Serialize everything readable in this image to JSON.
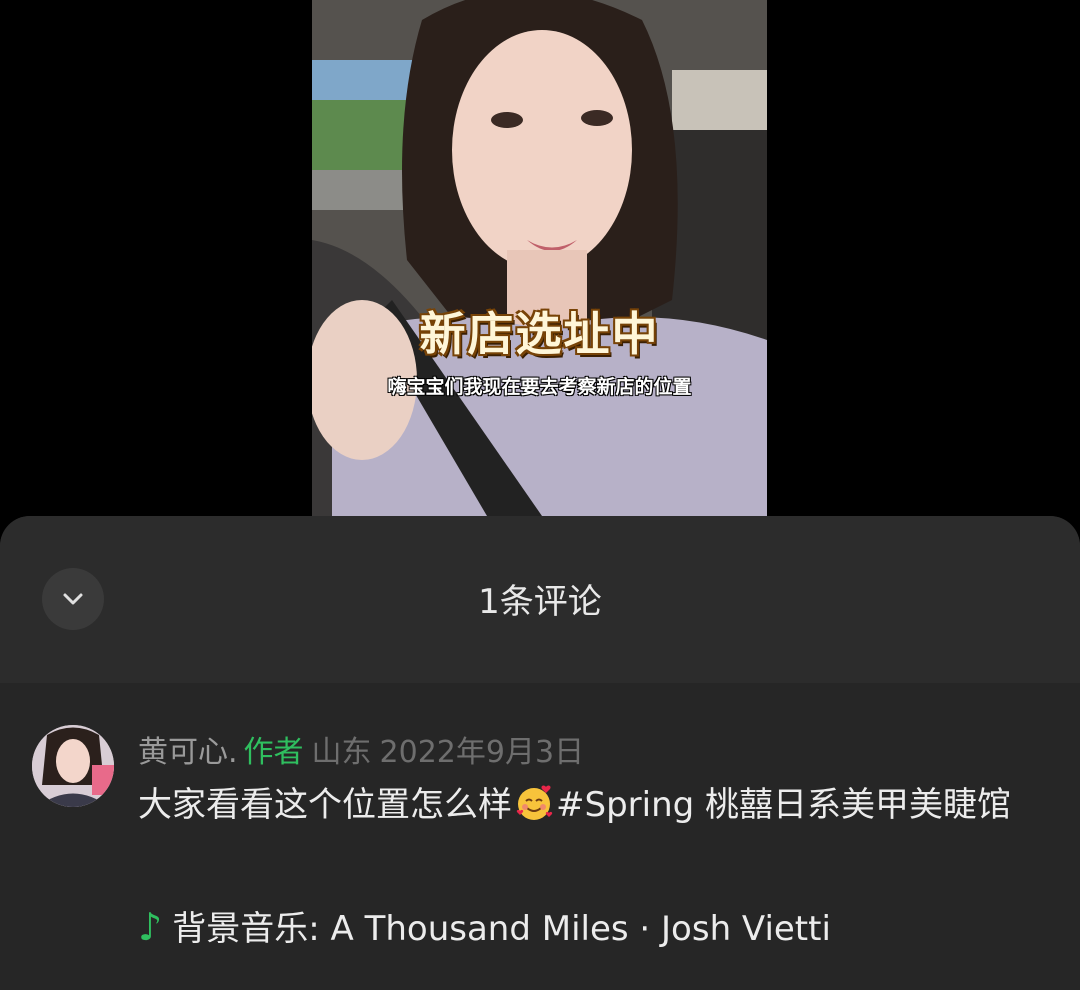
{
  "video": {
    "overlay_title": "新店选址中",
    "subtitle": "嗨宝宝们我现在要去考察新店的位置"
  },
  "sheet": {
    "title": "1条评论",
    "collapse_icon": "chevron-down-icon"
  },
  "comment": {
    "author_name": "黄可心.",
    "author_badge": "作者",
    "location": "山东",
    "date": "2022年9月3日",
    "text_before_emoji": "大家看看这个位置怎么样",
    "emoji": "smiling-face-with-hearts",
    "text_after_emoji": "#Spring 桃囍日系美甲美睫馆",
    "music_icon": "music-note-icon",
    "music_label": "背景音乐: A Thousand Miles · Josh Vietti"
  },
  "colors": {
    "accent_green": "#2fbf5f",
    "sheet_bg": "#262626",
    "header_bg": "#2c2c2c"
  }
}
